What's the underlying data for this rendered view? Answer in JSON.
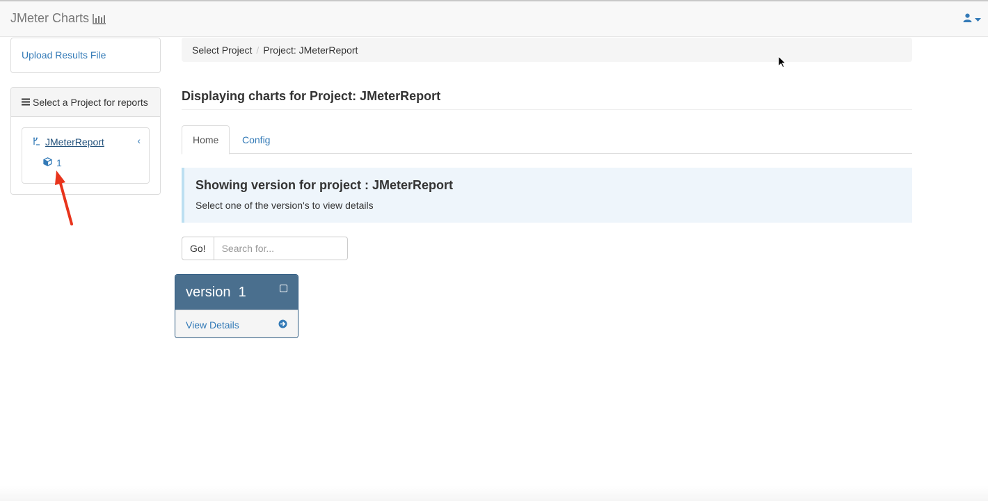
{
  "navbar": {
    "brand": "JMeter Charts",
    "brand_icon": "bar-chart-icon",
    "user_icon": "user-icon"
  },
  "sidebar": {
    "upload_label": "Upload Results File",
    "panel_heading": "Select a Project for reports",
    "panel_icon": "list-icon",
    "project_name": "JMeterReport",
    "project_icon": "code-fork-icon",
    "version_label": "1",
    "version_icon": "cube-icon"
  },
  "breadcrumb": {
    "items": [
      "Select Project",
      "Project: JMeterReport"
    ]
  },
  "main": {
    "title": "Displaying charts for Project: JMeterReport",
    "tabs": [
      {
        "label": "Home",
        "active": true
      },
      {
        "label": "Config",
        "active": false
      }
    ],
    "callout": {
      "heading": "Showing version for project : JMeterReport",
      "text": "Select one of the version's to view details"
    },
    "search": {
      "button": "Go!",
      "placeholder": "Search for..."
    },
    "version_card": {
      "title": "version  1",
      "details_label": "View Details"
    }
  },
  "colors": {
    "link": "#337ab7",
    "card_header": "#4a6f8e",
    "annotation_arrow": "#e8341c"
  }
}
